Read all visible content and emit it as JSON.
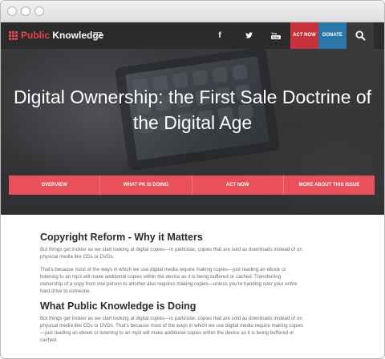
{
  "nav": {
    "logo_part1": "Public",
    "logo_part2": " Knowledge",
    "social": [
      "f",
      "★",
      "You"
    ],
    "act_now": "ACT NOW",
    "donate": "DONATE"
  },
  "hero": {
    "title": "Digital Ownership: the First Sale Doctrine of the Digital Age"
  },
  "tabs": [
    "OVERVIEW",
    "WHAT PK IS DOING",
    "ACT NOW",
    "MORE ABOUT THIS ISSUE"
  ],
  "sections": [
    {
      "title": "Copyright Reform - Why it Matters",
      "paragraphs": [
        "But things get trickier as we start looking at digital copies—in particular, copies that are sold as downloads instead of on physical media like CDs or DVDs.",
        "That's because most of the ways in which we use digital media require making copies—just reading an ebook or listening to an mp3 will make additional copies within the device as it is being buffered or cached. Transferring ownership of a copy from one person to another also requires making copies—unless you're handing over your entire hard drive to someone."
      ]
    },
    {
      "title": "What Public Knowledge is Doing",
      "paragraphs": [
        "But things get trickier as we start looking at digital copies—in particular, copies that are sold as downloads instead of on physical media like CDs or DVDs. That's because most of the ways in which we use digital media require making copies—just reading an ebook or listening to an mp3 will make additional copies within the device as it is being buffered or cached."
      ]
    }
  ]
}
